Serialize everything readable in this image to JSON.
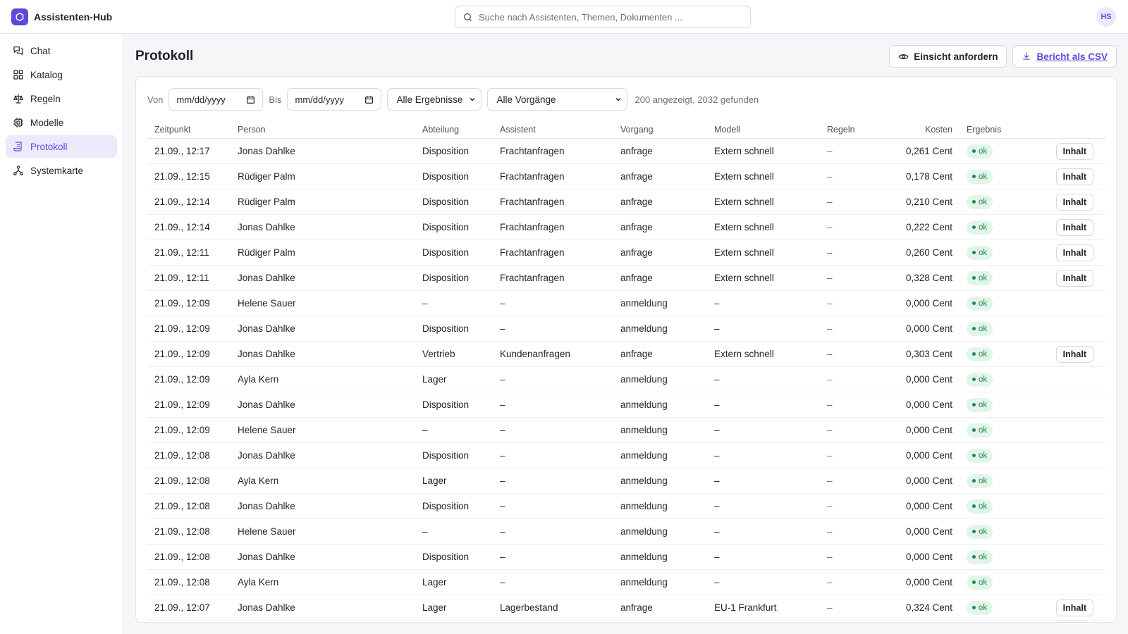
{
  "app": {
    "title": "Assistenten-Hub",
    "avatar_initials": "HS"
  },
  "search": {
    "placeholder": "Suche nach Assistenten, Themen, Dokumenten ..."
  },
  "sidebar": {
    "items": [
      {
        "label": "Chat",
        "icon": "chat-icon"
      },
      {
        "label": "Katalog",
        "icon": "grid-icon"
      },
      {
        "label": "Regeln",
        "icon": "scale-icon"
      },
      {
        "label": "Modelle",
        "icon": "chip-icon"
      },
      {
        "label": "Protokoll",
        "icon": "scroll-icon",
        "active": true
      },
      {
        "label": "Systemkarte",
        "icon": "network-icon"
      }
    ]
  },
  "page": {
    "title": "Protokoll",
    "actions": {
      "request_access": "Einsicht anfordern",
      "export_csv": "Bericht als CSV"
    }
  },
  "filters": {
    "from_label": "Von",
    "to_label": "Bis",
    "date_placeholder": "mm/dd/yyyy",
    "result_select": "Alle Ergebnisse",
    "process_select": "Alle Vorgänge",
    "count_text": "200 angezeigt, 2032 gefunden"
  },
  "table": {
    "columns": [
      "Zeitpunkt",
      "Person",
      "Abteilung",
      "Assistent",
      "Vorgang",
      "Modell",
      "Regeln",
      "Kosten",
      "Ergebnis"
    ],
    "content_button_label": "Inhalt",
    "rows": [
      {
        "time": "21.09., 12:17",
        "person": "Jonas Dahlke",
        "dept": "Disposition",
        "assistant": "Frachtanfragen",
        "process": "anfrage",
        "model": "Extern schnell",
        "rules": "–",
        "cost": "0,261 Cent",
        "result": "ok",
        "has_content": true
      },
      {
        "time": "21.09., 12:15",
        "person": "Rüdiger Palm",
        "dept": "Disposition",
        "assistant": "Frachtanfragen",
        "process": "anfrage",
        "model": "Extern schnell",
        "rules": "–",
        "cost": "0,178 Cent",
        "result": "ok",
        "has_content": true
      },
      {
        "time": "21.09., 12:14",
        "person": "Rüdiger Palm",
        "dept": "Disposition",
        "assistant": "Frachtanfragen",
        "process": "anfrage",
        "model": "Extern schnell",
        "rules": "–",
        "cost": "0,210 Cent",
        "result": "ok",
        "has_content": true
      },
      {
        "time": "21.09., 12:14",
        "person": "Jonas Dahlke",
        "dept": "Disposition",
        "assistant": "Frachtanfragen",
        "process": "anfrage",
        "model": "Extern schnell",
        "rules": "–",
        "cost": "0,222 Cent",
        "result": "ok",
        "has_content": true
      },
      {
        "time": "21.09., 12:11",
        "person": "Rüdiger Palm",
        "dept": "Disposition",
        "assistant": "Frachtanfragen",
        "process": "anfrage",
        "model": "Extern schnell",
        "rules": "–",
        "cost": "0,260 Cent",
        "result": "ok",
        "has_content": true
      },
      {
        "time": "21.09., 12:11",
        "person": "Jonas Dahlke",
        "dept": "Disposition",
        "assistant": "Frachtanfragen",
        "process": "anfrage",
        "model": "Extern schnell",
        "rules": "–",
        "cost": "0,328 Cent",
        "result": "ok",
        "has_content": true
      },
      {
        "time": "21.09., 12:09",
        "person": "Helene Sauer",
        "dept": "–",
        "assistant": "–",
        "process": "anmeldung",
        "model": "–",
        "rules": "–",
        "cost": "0,000 Cent",
        "result": "ok",
        "has_content": false
      },
      {
        "time": "21.09., 12:09",
        "person": "Jonas Dahlke",
        "dept": "Disposition",
        "assistant": "–",
        "process": "anmeldung",
        "model": "–",
        "rules": "–",
        "cost": "0,000 Cent",
        "result": "ok",
        "has_content": false
      },
      {
        "time": "21.09., 12:09",
        "person": "Jonas Dahlke",
        "dept": "Vertrieb",
        "assistant": "Kundenanfragen",
        "process": "anfrage",
        "model": "Extern schnell",
        "rules": "–",
        "cost": "0,303 Cent",
        "result": "ok",
        "has_content": true
      },
      {
        "time": "21.09., 12:09",
        "person": "Ayla Kern",
        "dept": "Lager",
        "assistant": "–",
        "process": "anmeldung",
        "model": "–",
        "rules": "–",
        "cost": "0,000 Cent",
        "result": "ok",
        "has_content": false
      },
      {
        "time": "21.09., 12:09",
        "person": "Jonas Dahlke",
        "dept": "Disposition",
        "assistant": "–",
        "process": "anmeldung",
        "model": "–",
        "rules": "–",
        "cost": "0,000 Cent",
        "result": "ok",
        "has_content": false
      },
      {
        "time": "21.09., 12:09",
        "person": "Helene Sauer",
        "dept": "–",
        "assistant": "–",
        "process": "anmeldung",
        "model": "–",
        "rules": "–",
        "cost": "0,000 Cent",
        "result": "ok",
        "has_content": false
      },
      {
        "time": "21.09., 12:08",
        "person": "Jonas Dahlke",
        "dept": "Disposition",
        "assistant": "–",
        "process": "anmeldung",
        "model": "–",
        "rules": "–",
        "cost": "0,000 Cent",
        "result": "ok",
        "has_content": false
      },
      {
        "time": "21.09., 12:08",
        "person": "Ayla Kern",
        "dept": "Lager",
        "assistant": "–",
        "process": "anmeldung",
        "model": "–",
        "rules": "–",
        "cost": "0,000 Cent",
        "result": "ok",
        "has_content": false
      },
      {
        "time": "21.09., 12:08",
        "person": "Jonas Dahlke",
        "dept": "Disposition",
        "assistant": "–",
        "process": "anmeldung",
        "model": "–",
        "rules": "–",
        "cost": "0,000 Cent",
        "result": "ok",
        "has_content": false
      },
      {
        "time": "21.09., 12:08",
        "person": "Helene Sauer",
        "dept": "–",
        "assistant": "–",
        "process": "anmeldung",
        "model": "–",
        "rules": "–",
        "cost": "0,000 Cent",
        "result": "ok",
        "has_content": false
      },
      {
        "time": "21.09., 12:08",
        "person": "Jonas Dahlke",
        "dept": "Disposition",
        "assistant": "–",
        "process": "anmeldung",
        "model": "–",
        "rules": "–",
        "cost": "0,000 Cent",
        "result": "ok",
        "has_content": false
      },
      {
        "time": "21.09., 12:08",
        "person": "Ayla Kern",
        "dept": "Lager",
        "assistant": "–",
        "process": "anmeldung",
        "model": "–",
        "rules": "–",
        "cost": "0,000 Cent",
        "result": "ok",
        "has_content": false
      },
      {
        "time": "21.09., 12:07",
        "person": "Jonas Dahlke",
        "dept": "Lager",
        "assistant": "Lagerbestand",
        "process": "anfrage",
        "model": "EU-1 Frankfurt",
        "rules": "–",
        "cost": "0,324 Cent",
        "result": "ok",
        "has_content": true
      }
    ]
  },
  "colors": {
    "accent": "#5b4bdb",
    "accent_soft": "#ece9fb",
    "ok_bg": "#e3f5ea",
    "ok_fg": "#1d8a4d"
  }
}
